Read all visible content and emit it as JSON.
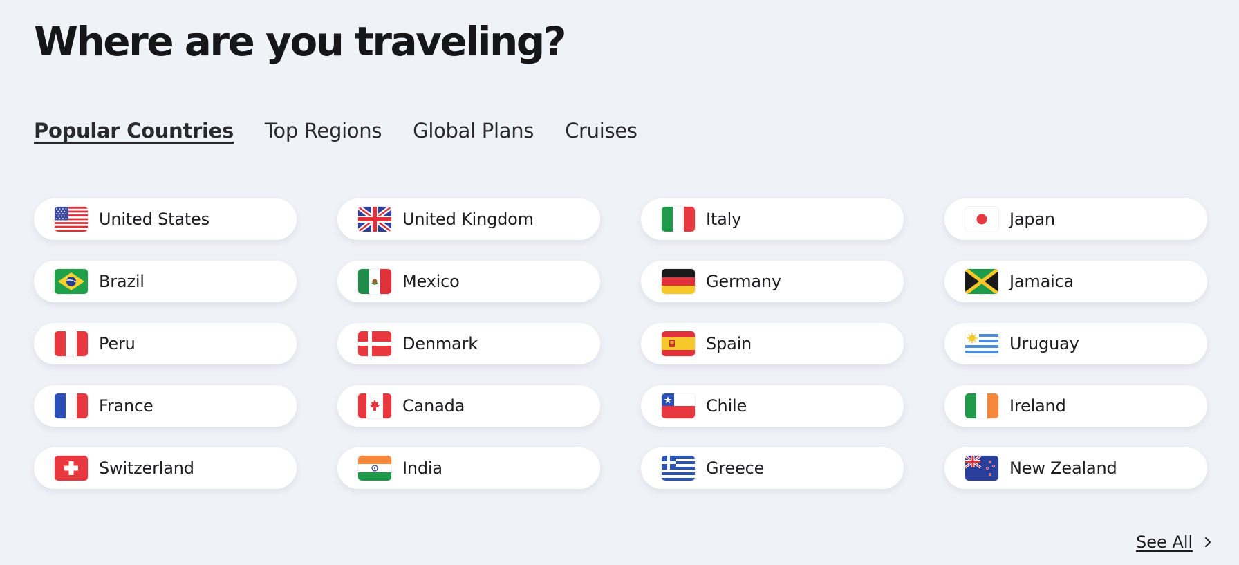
{
  "header": {
    "title": "Where are you traveling?"
  },
  "tabs": [
    {
      "label": "Popular Countries",
      "active": true
    },
    {
      "label": "Top Regions",
      "active": false
    },
    {
      "label": "Global Plans",
      "active": false
    },
    {
      "label": "Cruises",
      "active": false
    }
  ],
  "countries": [
    {
      "name": "United States",
      "flag": "us-flag-icon"
    },
    {
      "name": "United Kingdom",
      "flag": "uk-flag-icon"
    },
    {
      "name": "Italy",
      "flag": "italy-flag-icon"
    },
    {
      "name": "Japan",
      "flag": "japan-flag-icon"
    },
    {
      "name": "Brazil",
      "flag": "brazil-flag-icon"
    },
    {
      "name": "Mexico",
      "flag": "mexico-flag-icon"
    },
    {
      "name": "Germany",
      "flag": "germany-flag-icon"
    },
    {
      "name": "Jamaica",
      "flag": "jamaica-flag-icon"
    },
    {
      "name": "Peru",
      "flag": "peru-flag-icon"
    },
    {
      "name": "Denmark",
      "flag": "denmark-flag-icon"
    },
    {
      "name": "Spain",
      "flag": "spain-flag-icon"
    },
    {
      "name": "Uruguay",
      "flag": "uruguay-flag-icon"
    },
    {
      "name": "France",
      "flag": "france-flag-icon"
    },
    {
      "name": "Canada",
      "flag": "canada-flag-icon"
    },
    {
      "name": "Chile",
      "flag": "chile-flag-icon"
    },
    {
      "name": "Ireland",
      "flag": "ireland-flag-icon"
    },
    {
      "name": "Switzerland",
      "flag": "switzerland-flag-icon"
    },
    {
      "name": "India",
      "flag": "india-flag-icon"
    },
    {
      "name": "Greece",
      "flag": "greece-flag-icon"
    },
    {
      "name": "New Zealand",
      "flag": "new-zealand-flag-icon"
    }
  ],
  "footer": {
    "see_all_label": "See All",
    "see_all_icon": "chevron-right-icon"
  },
  "colors": {
    "background": "#eff2f7",
    "card": "#ffffff",
    "text": "#1d1d20"
  }
}
